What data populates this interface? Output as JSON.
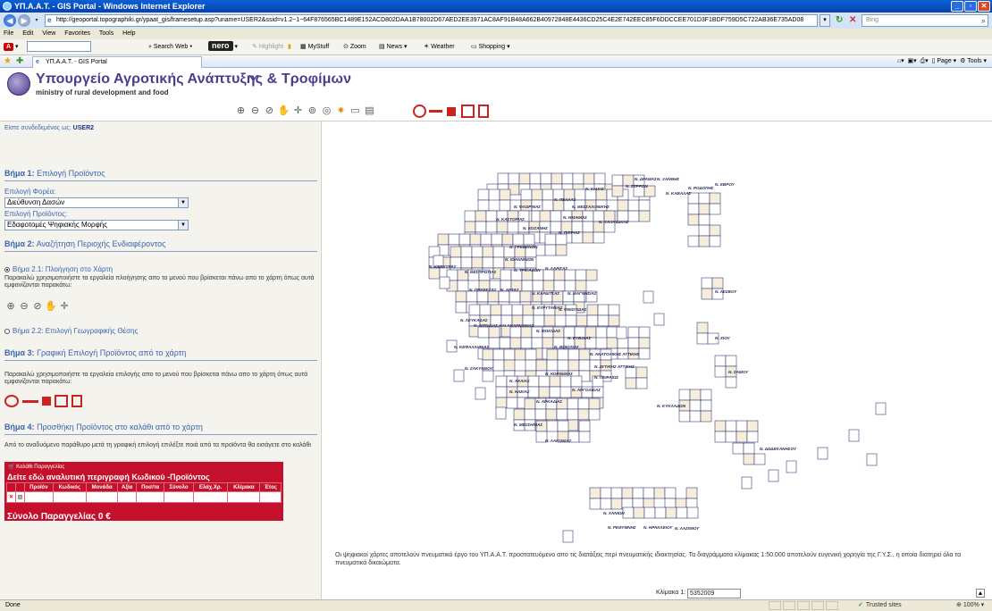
{
  "window": {
    "title": "ΥΠ.Α.Α.Τ. - GIS Portal - Windows Internet Explorer"
  },
  "address": {
    "url": "http://geoportal.topographiki.gr/ypaat_gis/framesetup.asp?uname=USER2&ssid=v1.2~1~64F876565BC1489E152ACD802DAA1B78002D67AED2EE3971AC8AF91B48A662B40972848E4436CD25C4E2E742EEC85F6DDCCEE701D3F1BDF759D5C722AB36E735AD08",
    "search_placeholder": "Bing"
  },
  "menu": [
    "File",
    "Edit",
    "View",
    "Favorites",
    "Tools",
    "Help"
  ],
  "toolbar": {
    "search_web": "Search Web",
    "nero": "nero",
    "highlight": "Highlight",
    "mystuff": "MyStuff",
    "zoom": "Zoom",
    "news": "News",
    "weather": "Weather",
    "shopping": "Shopping"
  },
  "tabs": {
    "active": "ΥΠ.Α.Α.Τ. - GIS Portal"
  },
  "ie_tools": {
    "page": "Page",
    "tools": "Tools"
  },
  "header": {
    "title": "Υπουργείο Αγροτικής Ανάπτυξης & Τροφίμων",
    "subtitle": "ministry of rural development and food"
  },
  "sidebar": {
    "login_prefix": "Είστε συνδεδεμένος ως:",
    "login_user": "USER2",
    "step1": {
      "num": "Βήμα 1:",
      "title": "Επιλογή Προϊόντος"
    },
    "agency_label": "Επιλογή Φορέα:",
    "agency_value": "Διεύθυνση Δασών",
    "product_label": "Επιλογή Προϊόντος:",
    "product_value": "Εδαφοτομές Ψηφιακής Μορφής",
    "step2": {
      "num": "Βήμα 2:",
      "title": "Αναζήτηση Περιοχής Ενδιαφέροντος"
    },
    "step21": "Βήμα 2.1: Πλοήγηση στο Χάρτη",
    "step21_text": "Παρακαλώ χρησιμοποιήστε τα εργαλεία πλοήγησης απο το μενού που βρίσκεται πάνω απο το χάρτη όπως αυτά εμφανίζονται παρακάτω:",
    "step22": "Βήμα 2.2: Επιλογή Γεωγραφικής Θέσης",
    "step3": {
      "num": "Βήμα 3:",
      "title": "Γραφική Επιλογή Προϊόντος από το χάρτη"
    },
    "step3_text": "Παρακαλώ χρησιμοποιήστε τα εργαλεία επιλογής απο το μενού που βρίσκεται πάνω απο το χάρτη όπως αυτά εμφανίζονται παρακάτω:",
    "step4": {
      "num": "Βήμα 4:",
      "title": "Προσθήκη Προϊόντος στο καλάθι από το χάρτη"
    },
    "step4_text": "Από το αναδυόμενο παράθυρο μετά τη γραφική επιλογή επιλέξτε ποιά από τα προϊόντα θα εισάγετε στο καλάθι"
  },
  "cart": {
    "title": "Καλάθι Παραγγελίας",
    "heading": "Δείτε εδώ αναλυτική περιγραφή Κωδικού -Προϊόντος",
    "columns": [
      "",
      "",
      "Προϊόν",
      "Κωδικός",
      "Μονάδα",
      "Αξία",
      "Ποσ/τα",
      "Σύνολο",
      "Ελάχ.Χρ.",
      "Κλίμακα",
      "Έτος"
    ],
    "total": "Σύνολο Παραγγελίας 0 €"
  },
  "map": {
    "note": "Οι ψηφιακοί χάρτες αποτελούν πνευματικό έργο του ΥΠ.Α.Α.Τ. προστατευόμενο απο τις διατάξεις περί πνευματικής ιδιοκτησίας. Τα διαγράμματα κλίμακας 1:50.000 αποτελούν ευγενική χορηγία της Γ.Υ.Σ., η οποία διατηρεί όλα τα πνευματικά δικαιώματα.",
    "scale_label": "Κλίμακα 1:",
    "scale_value": "5352009",
    "prefectures": [
      "Ν. ΔΡΑΜΑΣ",
      "Ν. ΞΑΝΘΗΣ",
      "Ν. ΕΒΡΟΥ",
      "Ν. ΡΟΔΟΠΗΣ",
      "Ν. ΚΑΒΑΛΑΣ",
      "Ν. ΣΕΡΡΩΝ",
      "Ν. ΚΙΛΚΙΣ",
      "Ν. ΠΕΛΛΑΣ",
      "Ν. ΦΛΩΡΙΝΑΣ",
      "Ν. ΘΕΣΣΑΛΟΝΙΚΗΣ",
      "Ν. ΗΜΑΘΙΑΣ",
      "Ν. ΚΑΣΤΟΡΙΑΣ",
      "Ν. ΧΑΛΚΙΔΙΚΗΣ",
      "Ν. ΚΟΖΑΝΗΣ",
      "Ν. ΠΙΕΡΙΑΣ",
      "Ν. ΓΡΕΒΕΝΩΝ",
      "Ν. ΙΩΑΝΝΙΝΩΝ",
      "Ν. ΚΕΡΚΥΡΑΣ",
      "Ν. ΘΕΣΠΡΩΤΙΑΣ",
      "Ν. ΤΡΙΚΑΛΩΝ",
      "Ν. ΛΑΡΙΣΑΣ",
      "Ν. ΠΡΕΒΕΖΑΣ",
      "Ν. ΑΡΤΑΣ",
      "Ν. ΚΑΡΔΙΤΣΑΣ",
      "Ν. ΜΑΓΝΗΣΙΑΣ",
      "Ν. ΛΕΣΒΟΥ",
      "Ν. ΕΥΡΥΤΑΝΙΑΣ",
      "Ν. ΦΘΙΩΤΙΔΑΣ",
      "Ν. ΛΕΥΚΑΔΑΣ",
      "Ν. ΑΙΤΩΛΙΑΣ ΚΑΙ ΑΚΑΡΝΑΝΙΑΣ",
      "Ν. ΦΩΚΙΔΑΣ",
      "Ν. ΕΥΒΟΙΑΣ",
      "Ν. ΧΙΟΥ",
      "Ν. ΚΕΦΑΛΛΗΝΙΑΣ",
      "Ν. ΒΟΙΩΤΙΑΣ",
      "Ν. ΑΝΑΤΟΛΙΚΗΣ ΑΤΤΙΚΗΣ",
      "Ν. ΔΥΤΙΚΗΣ ΑΤΤΙΚΗΣ",
      "Ν. ΑΧΑΙΑΣ",
      "Ν. ΚΟΡΙΝΘΙΑΣ",
      "Ν. ΖΑΚΥΝΘΟΥ",
      "Ν. ΣΑΜΟΥ",
      "Ν. ΠΕΙΡΑΙΩΣ",
      "Ν. ΗΛΕΙΑΣ",
      "Ν. ΑΡΓΟΛΙΔΑΣ",
      "Ν. ΑΡΚΑΔΙΑΣ",
      "Ν. ΚΥΚΛΑΔΩΝ",
      "Ν. ΜΕΣΣΗΝΙΑΣ",
      "Ν. ΛΑΚΩΝΙΑΣ",
      "Ν. ΔΩΔΕΚΑΝΗΣΟΥ",
      "Ν. ΧΑΝΙΩΝ",
      "Ν. ΡΕΘΥΜΝΗΣ",
      "Ν. ΗΡΑΚΛΕΙΟΥ",
      "Ν. ΛΑΣΙΘΙΟΥ"
    ]
  },
  "status": {
    "left": "Done",
    "zone": "Trusted sites",
    "zoom": "100%"
  }
}
